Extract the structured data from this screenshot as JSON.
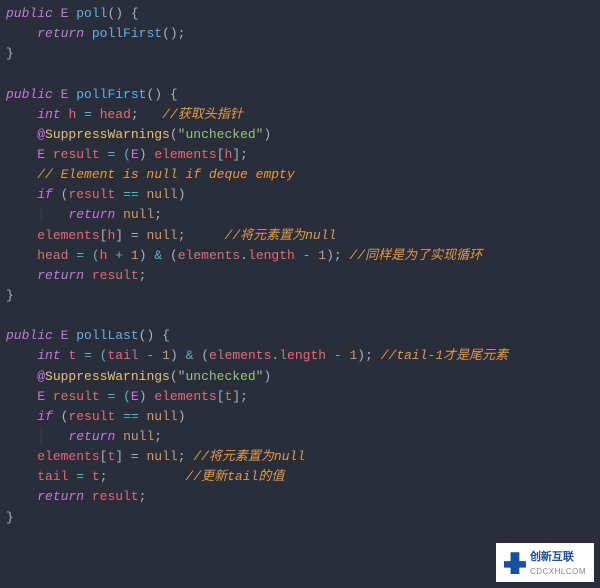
{
  "code": {
    "l1a": "public",
    "l1b": "E",
    "l1c": "poll",
    "l1d": "() {",
    "l2a": "return",
    "l2b": "pollFirst",
    "l2c": "();",
    "l3": "}",
    "l5a": "public",
    "l5b": "E",
    "l5c": "pollFirst",
    "l5d": "() {",
    "l6a": "int",
    "l6b": "h",
    "l6c": "=",
    "l6d": "head",
    "l6e": ";",
    "l6cm": "//获取头指针",
    "l7a": "@",
    "l7b": "SuppressWarnings",
    "l7c": "(",
    "l7d": "\"unchecked\"",
    "l7e": ")",
    "l8a": "E",
    "l8b": "result",
    "l8c": "= (",
    "l8d": "E",
    "l8e": ")",
    "l8f": "elements",
    "l8g": "[",
    "l8h": "h",
    "l8i": "];",
    "l9cm": "// Element is null if deque empty",
    "l10a": "if",
    "l10b": "(",
    "l10c": "result",
    "l10d": "==",
    "l10e": "null",
    "l10f": ")",
    "l11a": "return",
    "l11b": "null",
    "l11c": ";",
    "l12a": "elements",
    "l12b": "[",
    "l12c": "h",
    "l12d": "] =",
    "l12e": "null",
    "l12f": ";",
    "l12cm": "//将元素置为null",
    "l13a": "head",
    "l13b": "= (",
    "l13c": "h",
    "l13d": "+",
    "l13e": "1",
    "l13f": ")",
    "l13g": "&",
    "l13h": "(",
    "l13i": "elements",
    "l13j": ".",
    "l13k": "length",
    "l13l": "-",
    "l13m": "1",
    "l13n": ");",
    "l13cm": "//同样是为了实现循环",
    "l14a": "return",
    "l14b": "result",
    "l14c": ";",
    "l15": "}",
    "l17a": "public",
    "l17b": "E",
    "l17c": "pollLast",
    "l17d": "() {",
    "l18a": "int",
    "l18b": "t",
    "l18c": "= (",
    "l18d": "tail",
    "l18e": "-",
    "l18f": "1",
    "l18g": ")",
    "l18h": "&",
    "l18i": "(",
    "l18j": "elements",
    "l18k": ".",
    "l18l": "length",
    "l18m": "-",
    "l18n": "1",
    "l18o": ");",
    "l18cm": "//tail-1才是尾元素",
    "l19a": "@",
    "l19b": "SuppressWarnings",
    "l19c": "(",
    "l19d": "\"unchecked\"",
    "l19e": ")",
    "l20a": "E",
    "l20b": "result",
    "l20c": "= (",
    "l20d": "E",
    "l20e": ")",
    "l20f": "elements",
    "l20g": "[",
    "l20h": "t",
    "l20i": "];",
    "l21a": "if",
    "l21b": "(",
    "l21c": "result",
    "l21d": "==",
    "l21e": "null",
    "l21f": ")",
    "l22a": "return",
    "l22b": "null",
    "l22c": ";",
    "l23a": "elements",
    "l23b": "[",
    "l23c": "t",
    "l23d": "] =",
    "l23e": "null",
    "l23f": ";",
    "l23cm": "//将元素置为null",
    "l24a": "tail",
    "l24b": "=",
    "l24c": "t",
    "l24d": ";",
    "l24cm": "//更新tail的值",
    "l25a": "return",
    "l25b": "result",
    "l25c": ";",
    "l26": "}"
  },
  "watermark": {
    "title": "创新互联",
    "sub": "CDCXHLCOM"
  }
}
